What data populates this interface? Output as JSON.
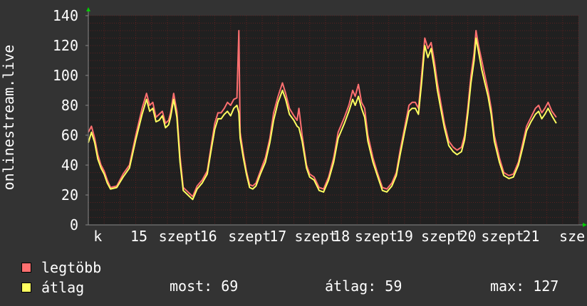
{
  "colors": {
    "background": "#333333",
    "plot_background": "#202020",
    "grid": "#5a2020",
    "max_series": "#ff7070",
    "avg_series": "#ffff60",
    "text": "#ffffff",
    "axis_arrow": "#00cc00"
  },
  "chart_data": {
    "type": "line",
    "ylabel": "onlinestream.live",
    "ylim": [
      0,
      140
    ],
    "yticks": [
      0,
      20,
      40,
      60,
      80,
      100,
      120,
      140
    ],
    "grid": true,
    "x_range_days": [
      14.0,
      21.75
    ],
    "xticks": [
      {
        "day": 14.15,
        "label": "k"
      },
      {
        "day": 14.8,
        "label": "15"
      },
      {
        "day": 15.45,
        "label": "szept"
      },
      {
        "day": 15.9,
        "label": "16"
      },
      {
        "day": 16.55,
        "label": "szept"
      },
      {
        "day": 17.0,
        "label": "17"
      },
      {
        "day": 17.6,
        "label": "szept"
      },
      {
        "day": 18.0,
        "label": "18"
      },
      {
        "day": 18.55,
        "label": "szept"
      },
      {
        "day": 19.0,
        "label": "19"
      },
      {
        "day": 19.6,
        "label": "szept"
      },
      {
        "day": 20.0,
        "label": "20"
      },
      {
        "day": 20.55,
        "label": "szept"
      },
      {
        "day": 21.0,
        "label": "21"
      },
      {
        "day": 21.65,
        "label": "sze"
      }
    ],
    "series": [
      {
        "name": "legtöbb",
        "color": "#ff7070",
        "points": [
          [
            14.0,
            62
          ],
          [
            14.05,
            66
          ],
          [
            14.1,
            58
          ],
          [
            14.15,
            47
          ],
          [
            14.2,
            40
          ],
          [
            14.25,
            36
          ],
          [
            14.3,
            30
          ],
          [
            14.35,
            25
          ],
          [
            14.45,
            26
          ],
          [
            14.55,
            34
          ],
          [
            14.65,
            40
          ],
          [
            14.75,
            60
          ],
          [
            14.85,
            78
          ],
          [
            14.92,
            88
          ],
          [
            14.97,
            80
          ],
          [
            15.02,
            82
          ],
          [
            15.07,
            72
          ],
          [
            15.12,
            74
          ],
          [
            15.17,
            76
          ],
          [
            15.22,
            68
          ],
          [
            15.27,
            70
          ],
          [
            15.3,
            75
          ],
          [
            15.35,
            88
          ],
          [
            15.4,
            76
          ],
          [
            15.45,
            46
          ],
          [
            15.5,
            25
          ],
          [
            15.55,
            23
          ],
          [
            15.6,
            21
          ],
          [
            15.65,
            19
          ],
          [
            15.72,
            26
          ],
          [
            15.8,
            30
          ],
          [
            15.88,
            36
          ],
          [
            15.95,
            55
          ],
          [
            16.0,
            68
          ],
          [
            16.05,
            75
          ],
          [
            16.1,
            75
          ],
          [
            16.15,
            78
          ],
          [
            16.2,
            82
          ],
          [
            16.25,
            80
          ],
          [
            16.3,
            84
          ],
          [
            16.35,
            85
          ],
          [
            16.38,
            130
          ],
          [
            16.4,
            62
          ],
          [
            16.45,
            48
          ],
          [
            16.5,
            36
          ],
          [
            16.55,
            27
          ],
          [
            16.6,
            26
          ],
          [
            16.65,
            28
          ],
          [
            16.72,
            36
          ],
          [
            16.8,
            45
          ],
          [
            16.87,
            58
          ],
          [
            16.93,
            75
          ],
          [
            17.0,
            86
          ],
          [
            17.07,
            95
          ],
          [
            17.12,
            88
          ],
          [
            17.18,
            78
          ],
          [
            17.25,
            73
          ],
          [
            17.3,
            70
          ],
          [
            17.33,
            78
          ],
          [
            17.38,
            60
          ],
          [
            17.45,
            40
          ],
          [
            17.5,
            34
          ],
          [
            17.57,
            32
          ],
          [
            17.65,
            25
          ],
          [
            17.72,
            24
          ],
          [
            17.8,
            32
          ],
          [
            17.88,
            45
          ],
          [
            17.95,
            62
          ],
          [
            18.05,
            72
          ],
          [
            18.12,
            80
          ],
          [
            18.18,
            90
          ],
          [
            18.22,
            86
          ],
          [
            18.27,
            94
          ],
          [
            18.32,
            82
          ],
          [
            18.37,
            78
          ],
          [
            18.42,
            60
          ],
          [
            18.5,
            45
          ],
          [
            18.57,
            35
          ],
          [
            18.65,
            25
          ],
          [
            18.72,
            24
          ],
          [
            18.8,
            28
          ],
          [
            18.87,
            35
          ],
          [
            18.93,
            50
          ],
          [
            19.0,
            65
          ],
          [
            19.07,
            80
          ],
          [
            19.12,
            82
          ],
          [
            19.17,
            82
          ],
          [
            19.22,
            78
          ],
          [
            19.27,
            100
          ],
          [
            19.32,
            125
          ],
          [
            19.37,
            118
          ],
          [
            19.42,
            122
          ],
          [
            19.47,
            110
          ],
          [
            19.52,
            95
          ],
          [
            19.58,
            80
          ],
          [
            19.63,
            68
          ],
          [
            19.7,
            56
          ],
          [
            19.77,
            52
          ],
          [
            19.83,
            50
          ],
          [
            19.9,
            52
          ],
          [
            19.95,
            60
          ],
          [
            20.0,
            78
          ],
          [
            20.05,
            100
          ],
          [
            20.1,
            115
          ],
          [
            20.13,
            130
          ],
          [
            20.17,
            120
          ],
          [
            20.22,
            110
          ],
          [
            20.27,
            100
          ],
          [
            20.32,
            90
          ],
          [
            20.37,
            78
          ],
          [
            20.42,
            60
          ],
          [
            20.5,
            45
          ],
          [
            20.57,
            35
          ],
          [
            20.65,
            33
          ],
          [
            20.72,
            34
          ],
          [
            20.8,
            42
          ],
          [
            20.87,
            55
          ],
          [
            20.93,
            66
          ],
          [
            21.0,
            72
          ],
          [
            21.07,
            78
          ],
          [
            21.12,
            80
          ],
          [
            21.17,
            75
          ],
          [
            21.22,
            78
          ],
          [
            21.27,
            82
          ],
          [
            21.33,
            76
          ],
          [
            21.4,
            72
          ]
        ]
      },
      {
        "name": "átlag",
        "color": "#ffff60",
        "points": [
          [
            14.0,
            55
          ],
          [
            14.05,
            62
          ],
          [
            14.1,
            55
          ],
          [
            14.15,
            44
          ],
          [
            14.2,
            38
          ],
          [
            14.25,
            34
          ],
          [
            14.3,
            28
          ],
          [
            14.35,
            24
          ],
          [
            14.45,
            25
          ],
          [
            14.55,
            32
          ],
          [
            14.65,
            38
          ],
          [
            14.75,
            57
          ],
          [
            14.85,
            74
          ],
          [
            14.92,
            84
          ],
          [
            14.97,
            76
          ],
          [
            15.02,
            78
          ],
          [
            15.07,
            69
          ],
          [
            15.12,
            70
          ],
          [
            15.17,
            73
          ],
          [
            15.22,
            65
          ],
          [
            15.27,
            67
          ],
          [
            15.3,
            72
          ],
          [
            15.35,
            84
          ],
          [
            15.4,
            72
          ],
          [
            15.45,
            42
          ],
          [
            15.5,
            23
          ],
          [
            15.55,
            21
          ],
          [
            15.6,
            19
          ],
          [
            15.65,
            17
          ],
          [
            15.72,
            24
          ],
          [
            15.8,
            28
          ],
          [
            15.88,
            34
          ],
          [
            15.95,
            52
          ],
          [
            16.0,
            64
          ],
          [
            16.05,
            71
          ],
          [
            16.1,
            71
          ],
          [
            16.15,
            74
          ],
          [
            16.2,
            76
          ],
          [
            16.25,
            73
          ],
          [
            16.3,
            78
          ],
          [
            16.35,
            80
          ],
          [
            16.38,
            75
          ],
          [
            16.4,
            58
          ],
          [
            16.45,
            45
          ],
          [
            16.5,
            34
          ],
          [
            16.55,
            25
          ],
          [
            16.6,
            24
          ],
          [
            16.65,
            26
          ],
          [
            16.72,
            34
          ],
          [
            16.8,
            42
          ],
          [
            16.87,
            55
          ],
          [
            16.93,
            70
          ],
          [
            17.0,
            82
          ],
          [
            17.07,
            90
          ],
          [
            17.12,
            84
          ],
          [
            17.18,
            74
          ],
          [
            17.25,
            70
          ],
          [
            17.3,
            66
          ],
          [
            17.33,
            65
          ],
          [
            17.38,
            56
          ],
          [
            17.45,
            38
          ],
          [
            17.5,
            32
          ],
          [
            17.57,
            30
          ],
          [
            17.65,
            23
          ],
          [
            17.72,
            22
          ],
          [
            17.8,
            30
          ],
          [
            17.88,
            42
          ],
          [
            17.95,
            58
          ],
          [
            18.05,
            68
          ],
          [
            18.12,
            76
          ],
          [
            18.18,
            84
          ],
          [
            18.22,
            80
          ],
          [
            18.27,
            86
          ],
          [
            18.32,
            78
          ],
          [
            18.37,
            72
          ],
          [
            18.42,
            56
          ],
          [
            18.5,
            42
          ],
          [
            18.57,
            33
          ],
          [
            18.65,
            23
          ],
          [
            18.72,
            22
          ],
          [
            18.8,
            26
          ],
          [
            18.87,
            33
          ],
          [
            18.93,
            47
          ],
          [
            19.0,
            62
          ],
          [
            19.07,
            76
          ],
          [
            19.12,
            78
          ],
          [
            19.17,
            78
          ],
          [
            19.22,
            74
          ],
          [
            19.27,
            95
          ],
          [
            19.32,
            120
          ],
          [
            19.37,
            112
          ],
          [
            19.42,
            118
          ],
          [
            19.47,
            105
          ],
          [
            19.52,
            90
          ],
          [
            19.58,
            76
          ],
          [
            19.63,
            65
          ],
          [
            19.7,
            53
          ],
          [
            19.77,
            49
          ],
          [
            19.83,
            47
          ],
          [
            19.9,
            49
          ],
          [
            19.95,
            57
          ],
          [
            20.0,
            74
          ],
          [
            20.05,
            95
          ],
          [
            20.1,
            110
          ],
          [
            20.13,
            125
          ],
          [
            20.17,
            116
          ],
          [
            20.22,
            104
          ],
          [
            20.27,
            95
          ],
          [
            20.32,
            86
          ],
          [
            20.37,
            74
          ],
          [
            20.42,
            56
          ],
          [
            20.5,
            42
          ],
          [
            20.57,
            33
          ],
          [
            20.65,
            31
          ],
          [
            20.72,
            32
          ],
          [
            20.8,
            40
          ],
          [
            20.87,
            52
          ],
          [
            20.93,
            63
          ],
          [
            21.0,
            69
          ],
          [
            21.07,
            74
          ],
          [
            21.12,
            76
          ],
          [
            21.17,
            71
          ],
          [
            21.22,
            74
          ],
          [
            21.27,
            78
          ],
          [
            21.33,
            73
          ],
          [
            21.4,
            68
          ]
        ]
      }
    ]
  },
  "legend": {
    "max_label": "legtöbb",
    "avg_label": "átlag"
  },
  "stats": {
    "now": "most: 69",
    "avg": "átlag: 59",
    "max": "max: 127"
  }
}
